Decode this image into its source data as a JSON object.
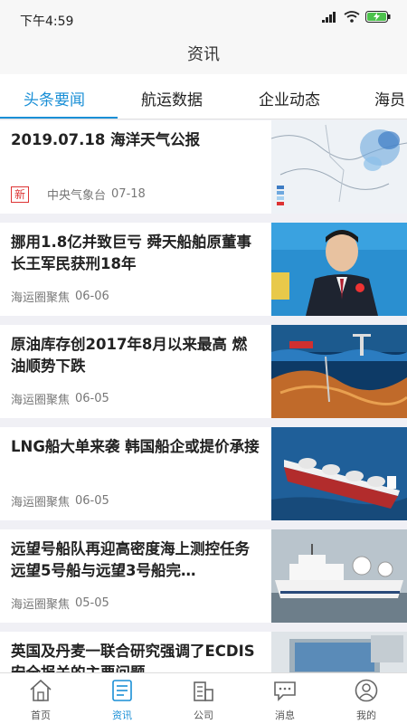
{
  "status_bar": {
    "time": "下午4:59"
  },
  "header": {
    "title": "资讯"
  },
  "tabs": [
    {
      "label": "头条要闻"
    },
    {
      "label": "航运数据"
    },
    {
      "label": "企业动态"
    },
    {
      "label": "海员"
    }
  ],
  "articles": [
    {
      "title": "2019.07.18 海洋天气公报",
      "badge": "新",
      "source": "中央气象台",
      "date": "07-18",
      "thumb_icon": "weather-map-image"
    },
    {
      "title": "挪用1.8亿并致巨亏 舜天船舶原董事长王军民获刑18年",
      "source": "海运圈聚焦",
      "date": "06-06",
      "thumb_icon": "person-photo-image"
    },
    {
      "title": "原油库存创2017年8月以来最高 燃油顺势下跌",
      "source": "海运圈聚焦",
      "date": "06-05",
      "thumb_icon": "oil-illustration-image"
    },
    {
      "title": "LNG船大单来袭 韩国船企或提价承接",
      "source": "海运圈聚焦",
      "date": "06-05",
      "thumb_icon": "lng-ship-image"
    },
    {
      "title": "远望号船队再迎高密度海上测控任务 远望5号船与远望3号船完…",
      "source": "海运圈聚焦",
      "date": "05-05",
      "thumb_icon": "tracking-ship-image"
    },
    {
      "title": "英国及丹麦一联合研究强调了ECDIS安全报关的主要问题",
      "source": "",
      "date": "",
      "thumb_icon": "ecdis-screen-image"
    }
  ],
  "bottom_nav": [
    {
      "label": "首页",
      "icon": "home-icon"
    },
    {
      "label": "资讯",
      "icon": "news-icon"
    },
    {
      "label": "公司",
      "icon": "company-icon"
    },
    {
      "label": "消息",
      "icon": "message-icon"
    },
    {
      "label": "我的",
      "icon": "profile-icon"
    }
  ],
  "colors": {
    "accent": "#1a8fd6",
    "badge_red": "#dd3333"
  }
}
